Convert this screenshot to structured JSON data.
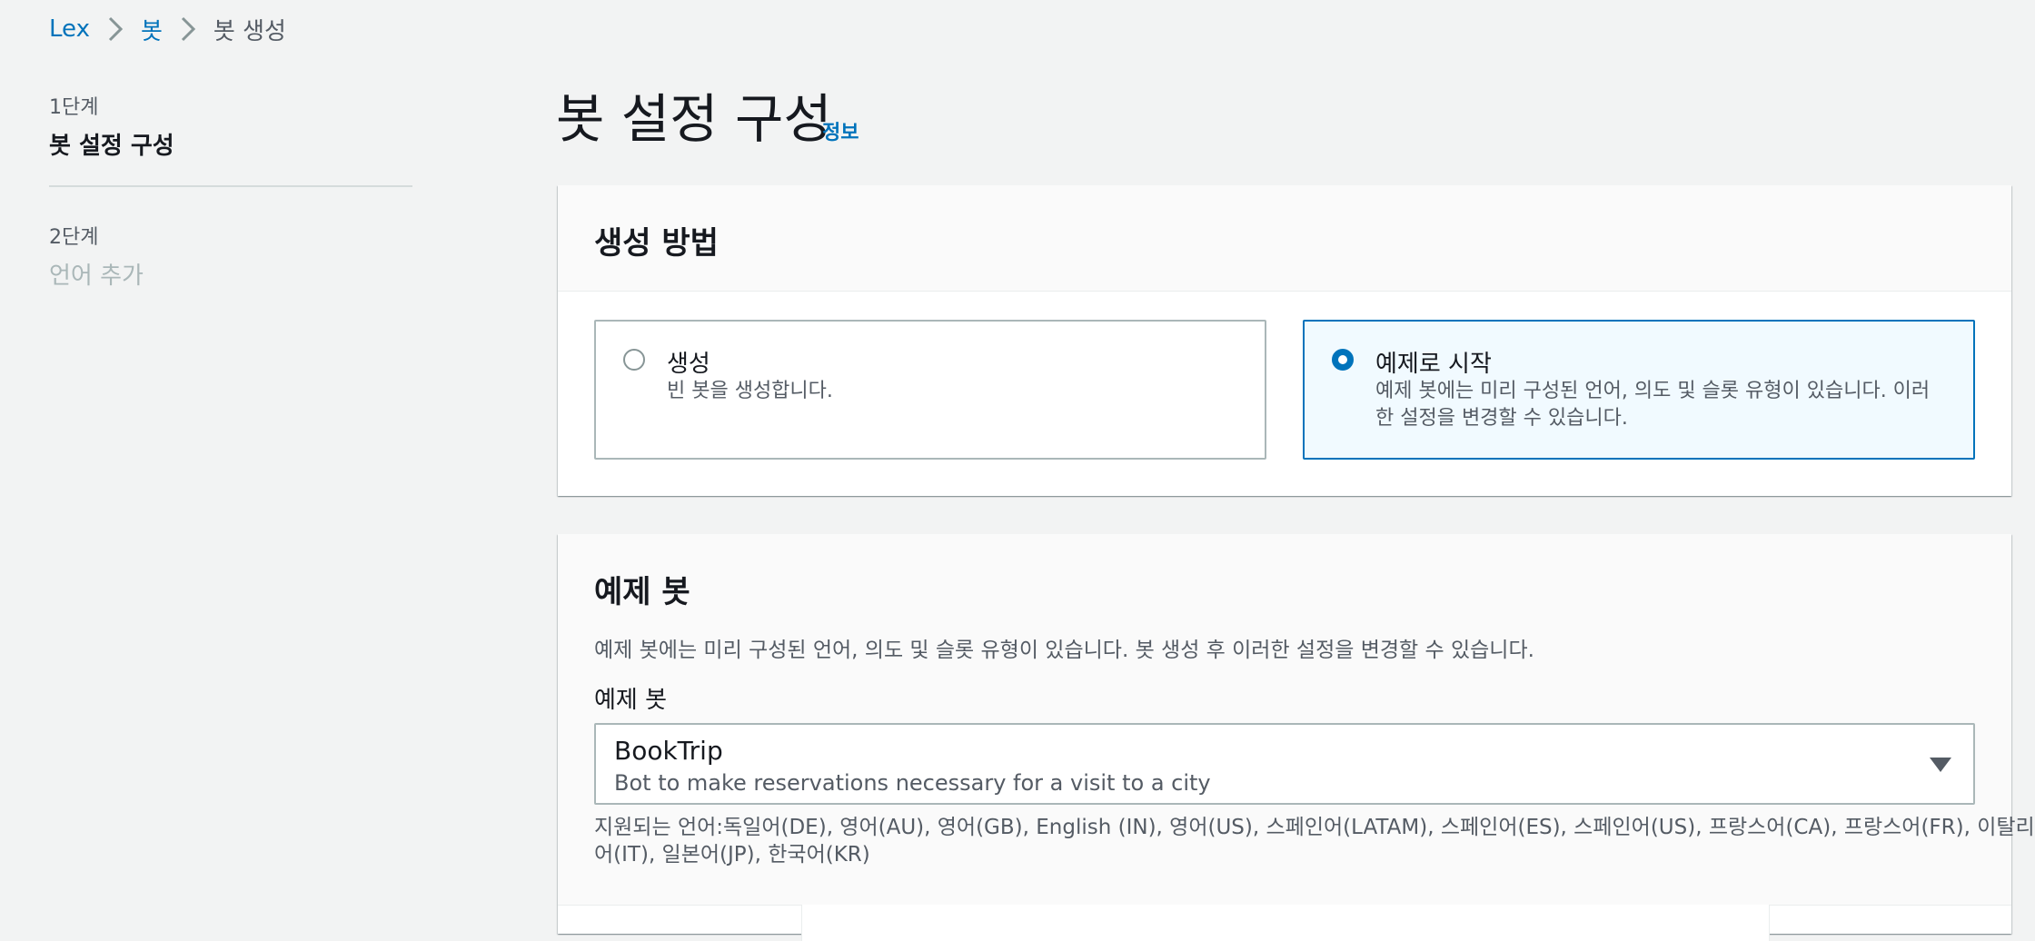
{
  "breadcrumb": {
    "items": [
      "Lex",
      "봇",
      "봇 생성"
    ]
  },
  "steps": [
    {
      "label": "1단계",
      "title": "봇 설정 구성",
      "active": true
    },
    {
      "label": "2단계",
      "title": "언어 추가",
      "active": false
    }
  ],
  "page": {
    "title": "봇 설정 구성",
    "info_link": "정보"
  },
  "creation_method": {
    "title": "생성 방법",
    "options": [
      {
        "title": "생성",
        "description": "빈 봇을 생성합니다.",
        "selected": false
      },
      {
        "title": "예제로 시작",
        "description_line1": "예제 봇에는 미리 구성된 언어, 의도 및 슬롯 유형이 있습니다. 이러",
        "description_line2": "한 설정을 변경할 수 있습니다.",
        "selected": true
      }
    ]
  },
  "example_bot": {
    "title": "예제 봇",
    "description": "예제 봇에는 미리 구성된 언어, 의도 및 슬롯 유형이 있습니다. 봇 생성 후 이러한 설정을 변경할 수 있습니다.",
    "field_label": "예제 봇",
    "selected_value": "BookTrip",
    "selected_description": "Bot to make reservations necessary for a visit to a city",
    "supported_languages_line1": "지원되는 언어:독일어(DE), 영어(AU), 영어(GB), English (IN), 영어(US), 스페인어(LATAM), 스페인어(ES), 스페인어(US), 프랑스어(CA), 프랑스어(FR), 이탈리아",
    "supported_languages_line2": "어(IT), 일본어(JP), 한국어(KR)"
  },
  "colors": {
    "link": "#0073bb",
    "selected_tile_bg": "#f1faff",
    "page_bg": "#f2f3f3"
  },
  "icons": {
    "breadcrumb_separator": "chevron-right-icon",
    "dropdown": "caret-down-icon"
  }
}
